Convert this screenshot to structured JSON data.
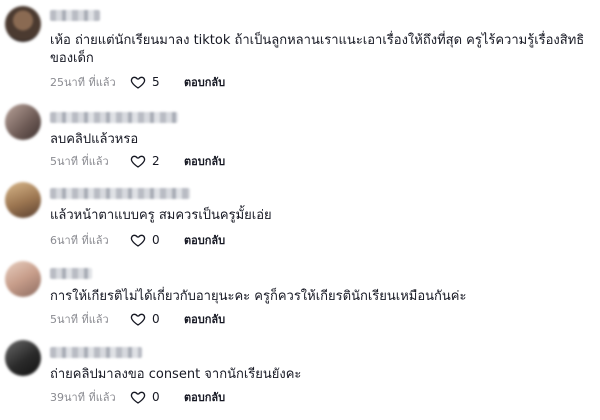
{
  "comments": [
    {
      "text": "เห้อ ถ่ายแต่นักเรียนมาลง tiktok ถ้าเป็นลูกหลานเราแนะเอาเรื่องให้ถึงที่สุด ครูไร้ความรู้เรื่องสิทธิของเด็ก",
      "time": "25นาที ที่แล้ว",
      "likes": "5",
      "reply": "ตอบกลับ"
    },
    {
      "text": "ลบคลิปแล้วหรอ",
      "time": "5นาที ที่แล้ว",
      "likes": "2",
      "reply": "ตอบกลับ"
    },
    {
      "text": "แล้วหน้าตาแบบครู สมควรเป็นครูมั้ยเอ่ย",
      "time": "6นาที ที่แล้ว",
      "likes": "0",
      "reply": "ตอบกลับ"
    },
    {
      "text": "การให้เกียรติไม่ได้เกี่ยวกับอายุนะคะ ครูก็ควรให้เกียรตินักเรียนเหมือนกันค่ะ",
      "time": "5นาที ที่แล้ว",
      "likes": "0",
      "reply": "ตอบกลับ"
    },
    {
      "text": "ถ่ายคลิปมาลงขอ consent จากนักเรียนยังคะ",
      "time": "39นาที ที่แล้ว",
      "likes": "0",
      "reply": "ตอบกลับ"
    }
  ],
  "icons": {
    "like": "heart-outline-icon"
  },
  "colors": {
    "text": "#161823",
    "muted": "#8a8b91"
  }
}
